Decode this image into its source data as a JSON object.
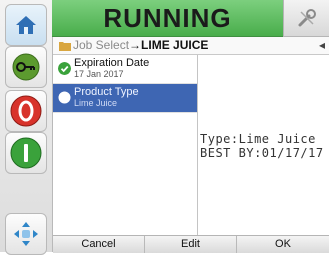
{
  "status": {
    "text": "RUNNING"
  },
  "breadcrumb": {
    "parent": "Job Select",
    "separator": "→",
    "current": "LIME JUICE",
    "nav_arrow": "◂"
  },
  "list": {
    "items": [
      {
        "title": "Expiration Date",
        "subtitle": "17 Jan 2017",
        "status_icon": "green-check-icon",
        "selected": false
      },
      {
        "title": "Product Type",
        "subtitle": "Lime Juice",
        "status_icon": "white-dot-icon",
        "selected": true
      }
    ]
  },
  "preview": {
    "line1": "Type:Lime Juice",
    "line2": "BEST BY:01/17/17"
  },
  "buttons": {
    "cancel": "Cancel",
    "edit": "Edit",
    "ok": "OK"
  },
  "colors": {
    "running_green": "#49ad4b",
    "selection_blue": "#3e66b3",
    "stop_red": "#d8332b",
    "start_green": "#3aa23b"
  }
}
